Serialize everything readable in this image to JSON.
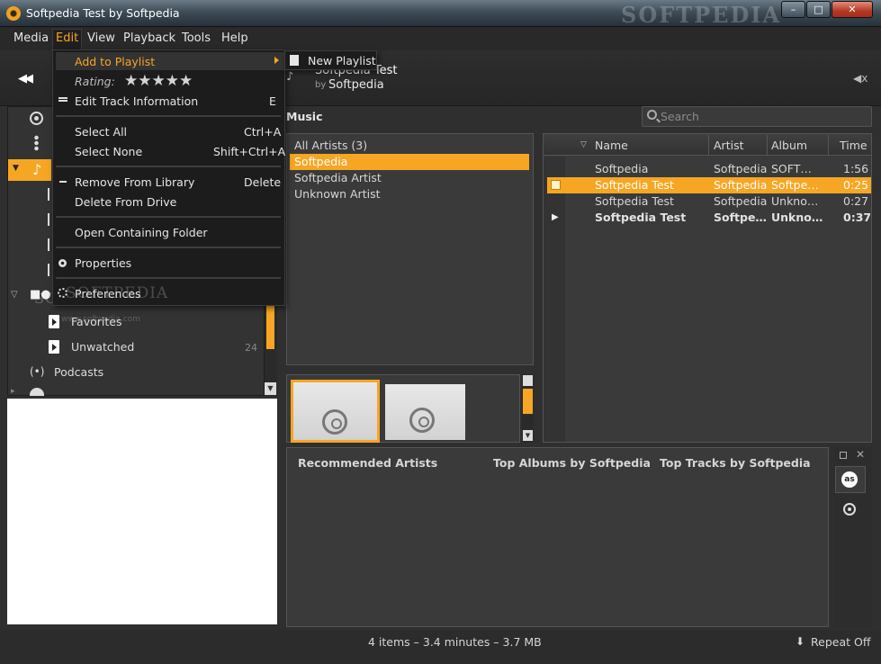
{
  "window": {
    "title": "Softpedia Test by Softpedia",
    "watermark": "SOFTPEDIA",
    "controls": {
      "minimize": "–",
      "maximize": "□",
      "close": "✕"
    }
  },
  "menubar": {
    "items": [
      "Media",
      "Edit",
      "View",
      "Playback",
      "Tools",
      "Help"
    ],
    "active": "Edit"
  },
  "now_playing": {
    "title": "Softpedia Test",
    "by_label": "by",
    "artist": "Softpedia"
  },
  "edit_menu": {
    "add_to_playlist": "Add to Playlist",
    "rating_label": "Rating:",
    "rating_stars": "★★★★★",
    "edit_track_info": "Edit Track Information",
    "edit_track_info_shortcut": "E",
    "select_all": "Select All",
    "select_all_shortcut": "Ctrl+A",
    "select_none": "Select None",
    "select_none_shortcut": "Shift+Ctrl+A",
    "remove_from_library": "Remove From Library",
    "remove_from_library_shortcut": "Delete",
    "delete_from_drive": "Delete From Drive",
    "open_containing_folder": "Open Containing Folder",
    "properties": "Properties",
    "preferences": "Preferences"
  },
  "submenu": {
    "new_playlist": "New Playlist"
  },
  "sidebar": {
    "favorites": "Favorites",
    "unwatched": "Unwatched",
    "unwatched_count": "24",
    "podcasts": "Podcasts",
    "watermark": "SOFTPEDIA",
    "watermark_url": "www.softpedia.com"
  },
  "music": {
    "label": "Music",
    "search_placeholder": "Search",
    "artists": [
      {
        "name": "All Artists (3)",
        "selected": false
      },
      {
        "name": "Softpedia",
        "selected": true
      },
      {
        "name": "Softpedia Artist",
        "selected": false
      },
      {
        "name": "Unknown Artist",
        "selected": false
      }
    ],
    "columns": {
      "name": "Name",
      "artist": "Artist",
      "album": "Album",
      "time": "Time"
    },
    "tracks": [
      {
        "name": "Softpedia",
        "artist": "Softpedia",
        "album": "SOFT…",
        "time": "1:56",
        "selected": false,
        "playing": false
      },
      {
        "name": "Softpedia Test",
        "artist": "Softpedia",
        "album": "Softpe…",
        "time": "0:25",
        "selected": true,
        "playing": false
      },
      {
        "name": "Softpedia Test",
        "artist": "Softpedia",
        "album": "Unkno…",
        "time": "0:27",
        "selected": false,
        "playing": false
      },
      {
        "name": "Softpedia Test",
        "artist": "Softpe…",
        "album": "Unkno…",
        "time": "0:37",
        "selected": false,
        "playing": true
      }
    ]
  },
  "recommendations": {
    "artists": "Recommended Artists",
    "albums": "Top Albums by Softpedia",
    "tracks": "Top Tracks by Softpedia",
    "lastfm": "as"
  },
  "status": {
    "summary": "4 items – 3.4 minutes – 3.7 MB",
    "repeat": "Repeat Off"
  },
  "colors": {
    "accent": "#f6a623",
    "background": "#2f2f2f",
    "panel": "#3a3a3a"
  }
}
